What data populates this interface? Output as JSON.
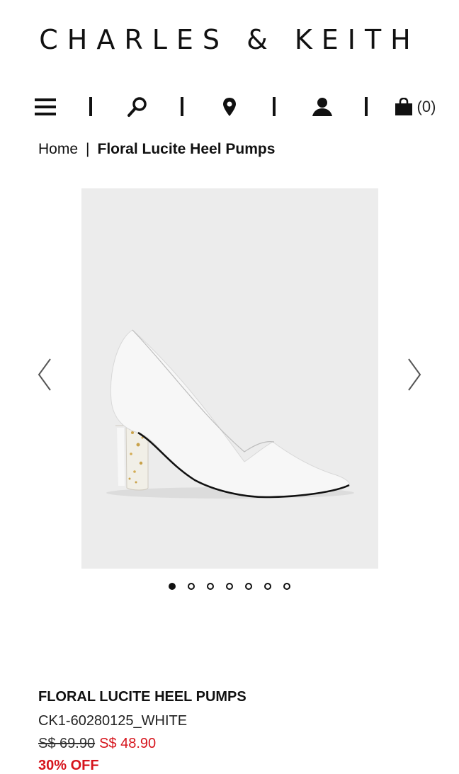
{
  "brand": {
    "name": "CHARLES & KEITH"
  },
  "nav": {
    "icons": [
      "menu-icon",
      "search-icon",
      "location-pin-icon",
      "account-icon",
      "shopping-bag-icon"
    ],
    "cart_count": "(0)"
  },
  "breadcrumb": {
    "home": "Home",
    "separator": "|",
    "current": "Floral Lucite Heel Pumps"
  },
  "gallery": {
    "image": "white pointed-toe pump with clear lucite block heel containing gold flakes",
    "prev_icon": "chevron-left-icon",
    "next_icon": "chevron-right-icon",
    "slide_count": 7,
    "active_slide": 1
  },
  "product": {
    "name": "FLORAL LUCITE HEEL PUMPS",
    "sku": "CK1-60280125_WHITE",
    "old_price": "S$ 69.90",
    "new_price": "S$ 48.90",
    "discount": "30% OFF"
  },
  "colors": {
    "sale": "#d6141c",
    "text": "#111111",
    "gallery_bg": "#ececec"
  }
}
